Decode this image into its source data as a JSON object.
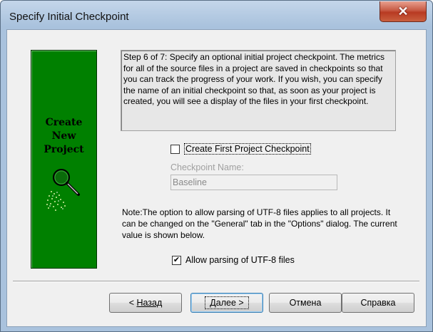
{
  "window": {
    "title": "Specify Initial Checkpoint",
    "close_glyph": "✕"
  },
  "side_panel": {
    "line1": "Create",
    "line2": "New",
    "line3": "Project",
    "bg_color": "#008000",
    "icon": "magnifier-icon"
  },
  "description": "Step 6 of 7: Specify an optional initial project checkpoint. The metrics for all of the source files in a project are saved in checkpoints so that you can track the progress of your work. If you wish, you can specify the name of an initial checkpoint so that, as soon as your project is created, you will see a display of the files in your first checkpoint.",
  "create_checkpoint": {
    "label": "Create First Project Checkpoint",
    "checked": false
  },
  "checkpoint_name": {
    "label": "Checkpoint Name:",
    "value": "Baseline"
  },
  "note": "Note:The option to allow parsing of UTF-8 files applies to all projects. It can be changed on the \"General\" tab in the \"Options\" dialog. The current value is shown below.",
  "utf8": {
    "label": "Allow parsing of UTF-8 files",
    "checked": true,
    "check_glyph": "✔"
  },
  "buttons": {
    "back_prefix": "< ",
    "back_label": "Назад",
    "next_label": "Далее >",
    "cancel_label": "Отмена",
    "help_label": "Справка"
  }
}
